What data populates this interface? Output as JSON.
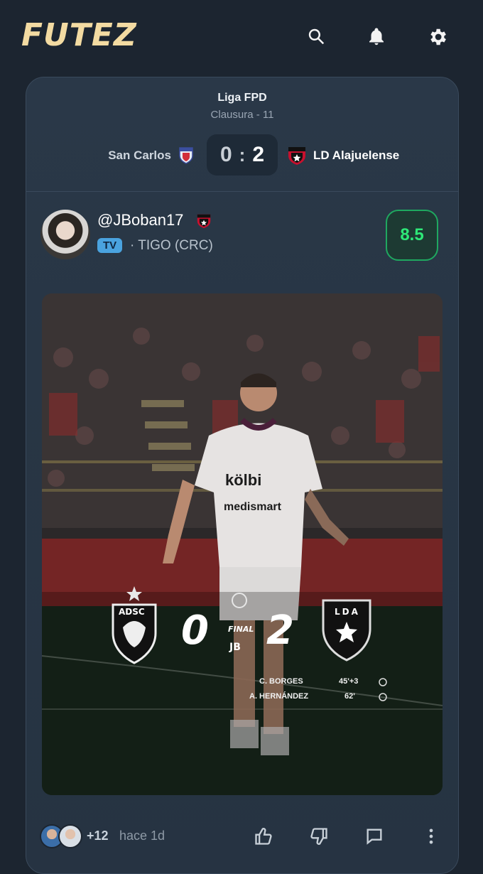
{
  "app": {
    "name": "FUTEZ"
  },
  "topbar": {
    "icons": [
      "search-icon",
      "bell-icon",
      "settings-icon"
    ]
  },
  "match": {
    "league": "Liga FPD",
    "round": "Clausura - 11",
    "home_team": "San Carlos",
    "away_team": "LD Alajuelense",
    "home_score": "0",
    "separator": ":",
    "away_score": "2"
  },
  "post": {
    "username": "@JBoban17",
    "tv_badge": "TV",
    "channel": "· TIGO (CRC)",
    "rating": "8.5"
  },
  "image_overlay": {
    "home_crest_label": "ADSC",
    "away_crest_label": "LDA",
    "home_score": "0",
    "away_score": "2",
    "status": "FINAL",
    "signature": "JB",
    "scorers": [
      {
        "name": "C. BORGES",
        "minute": "45'+3"
      },
      {
        "name": "A. HERNÁNDEZ",
        "minute": "62'"
      }
    ]
  },
  "footer": {
    "more_count": "+12",
    "time_ago": "hace 1d",
    "actions": [
      "thumbs-up-icon",
      "thumbs-down-icon",
      "comment-icon",
      "more-vertical-icon"
    ]
  },
  "colors": {
    "background": "#1c2530",
    "card": "#283645",
    "logo": "#f3dba2",
    "rating_green": "#2ee878",
    "tv_badge": "#4aa3df",
    "away_red": "#c8102e"
  }
}
